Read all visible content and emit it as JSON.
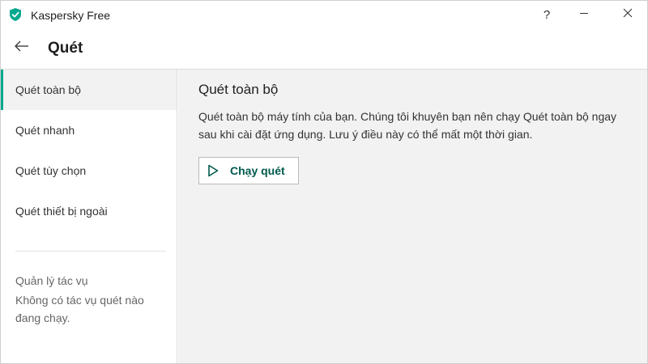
{
  "window": {
    "title": "Kaspersky Free",
    "help_label": "?",
    "minimize_label": "—",
    "close_label": "✕"
  },
  "header": {
    "title": "Quét"
  },
  "sidebar": {
    "items": [
      {
        "label": "Quét toàn bộ",
        "active": true
      },
      {
        "label": "Quét nhanh",
        "active": false
      },
      {
        "label": "Quét tùy chọn",
        "active": false
      },
      {
        "label": "Quét thiết bị ngoài",
        "active": false
      }
    ],
    "task_manager": {
      "title": "Quản lý tác vụ",
      "status": "Không có tác vụ quét nào đang chạy."
    }
  },
  "main": {
    "title": "Quét toàn bộ",
    "description": "Quét toàn bộ máy tính của bạn. Chúng tôi khuyên bạn nên chạy Quét toàn bộ ngay sau khi cài đặt ứng dụng. Lưu ý điều này có thể mất một thời gian.",
    "run_button_label": "Chạy quét"
  },
  "colors": {
    "accent": "#00a88e",
    "button_text": "#005a4c",
    "content_bg": "#f2f2f2"
  }
}
